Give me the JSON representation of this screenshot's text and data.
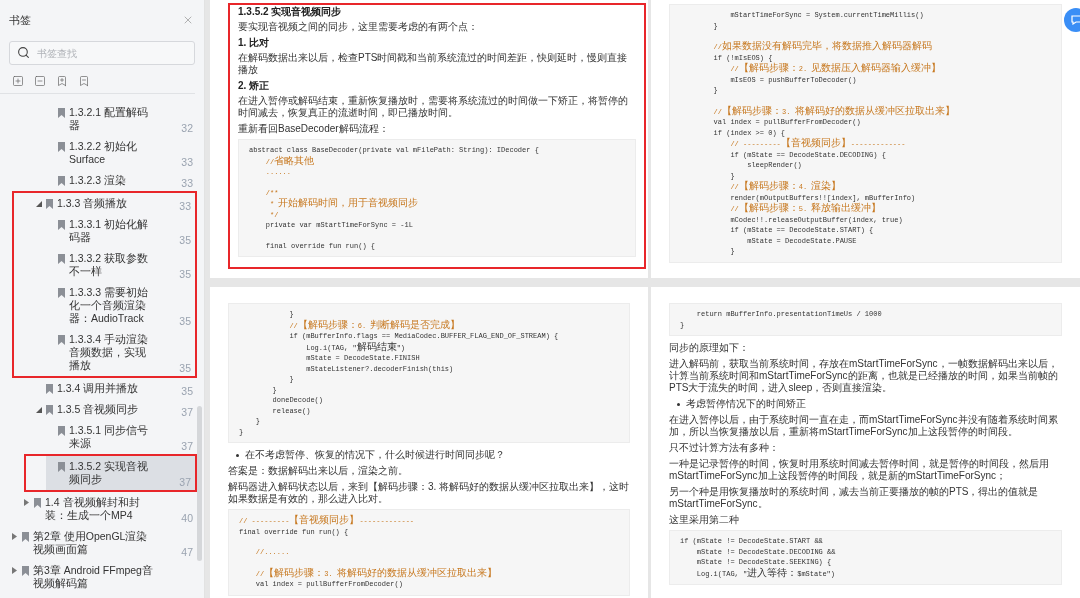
{
  "sidebar": {
    "title": "书签",
    "search": {
      "placeholder": "书签查找"
    },
    "tree": [
      {
        "children": [
          {
            "children": [
              {
                "children": [
                  {
                    "label": "1.3.2.1 配置解码器",
                    "page": "32",
                    "selected": false,
                    "annotated": false
                  },
                  {
                    "label": "1.3.2.2 初始化Surface",
                    "page": "33",
                    "selected": false,
                    "annotated": false
                  },
                  {
                    "label": "1.3.2.3 渲染",
                    "page": "33",
                    "selected": false,
                    "annotated": false
                  }
                ]
              },
              {
                "label": "1.3.3 音频播放",
                "page": "33",
                "expanded": true,
                "selected": false,
                "annotated": true,
                "children": [
                  {
                    "label": "1.3.3.1 初始化解码器",
                    "page": "35",
                    "selected": false,
                    "annotated": false
                  },
                  {
                    "label": "1.3.3.2 获取参数不一样",
                    "page": "35",
                    "selected": false,
                    "annotated": false
                  },
                  {
                    "label": "1.3.3.3 需要初始化一个音频渲染器：AudioTrack",
                    "page": "35",
                    "selected": false,
                    "annotated": false
                  },
                  {
                    "label": "1.3.3.4 手动渲染音频数据，实现播放",
                    "page": "35",
                    "selected": false,
                    "annotated": false
                  }
                ]
              },
              {
                "label": "1.3.4 调用并播放",
                "page": "35",
                "selected": false,
                "annotated": false
              },
              {
                "label": "1.3.5 音视频同步",
                "page": "37",
                "expanded": true,
                "selected": false,
                "annotated": false,
                "children": [
                  {
                    "label": "1.3.5.1 同步信号来源",
                    "page": "37",
                    "selected": false,
                    "annotated": false
                  },
                  {
                    "label": "1.3.5.2 实现音视频同步",
                    "page": "37",
                    "selected": true,
                    "annotated": true
                  }
                ]
              }
            ]
          },
          {
            "label": "1.4 音视频解封和封装：生成一个MP4",
            "page": "40",
            "expanded": false,
            "selected": false,
            "annotated": false
          }
        ]
      },
      {
        "label": "第2章 使用OpenGL渲染视频画面篇",
        "page": "47",
        "expanded": false,
        "selected": false,
        "annotated": false
      },
      {
        "label": "第3章 Android FFmpeg音视频解码篇",
        "expanded": false,
        "selected": false,
        "annotated": false
      }
    ]
  },
  "pages": [
    {
      "annotated": true,
      "blocks": [
        {
          "kind": "heading",
          "text": "1.3.5.2 实现音视频同步"
        },
        {
          "kind": "paragraph",
          "text": "要实现音视频之间的同步，这里需要考虑的有两个点："
        },
        {
          "kind": "heading",
          "text": "1. 比对"
        },
        {
          "kind": "paragraph",
          "text": "在解码数据出来以后，检查PTS时间戳和当前系统流过的时间差距，快则延时，慢则直接播放"
        },
        {
          "kind": "heading",
          "text": "2. 矫正"
        },
        {
          "kind": "paragraph",
          "text": "在进入暂停或解码结束，重新恢复播放时，需要将系统流过的时间做一下矫正，将暂停的时间减去，恢复真正的流逝时间，即已播放时间。"
        },
        {
          "kind": "paragraph",
          "text": "重新看回BaseDecoder解码流程："
        },
        {
          "kind": "code",
          "lines": [
            {
              "kind": "code",
              "text": "abstract class BaseDecoder(private val mFilePath: String): IDecoder {"
            },
            {
              "kind": "comment",
              "text": "    //省略其他"
            },
            {
              "kind": "comment",
              "text": "    ......"
            },
            {
              "kind": "blank"
            },
            {
              "kind": "comment",
              "text": "    /**"
            },
            {
              "kind": "comment",
              "text": "     * 开始解码时间，用于音视频同步"
            },
            {
              "kind": "comment",
              "text": "     */"
            },
            {
              "kind": "code",
              "text": "    private var mStartTimeForSync = -1L"
            },
            {
              "kind": "blank"
            },
            {
              "kind": "code",
              "text": "    final override fun run() {"
            }
          ]
        }
      ]
    },
    {
      "annotated": false,
      "blocks": [
        {
          "kind": "code",
          "lines": [
            {
              "kind": "code",
              "text": "            mStartTimeForSync = System.currentTimeMillis()"
            },
            {
              "kind": "code",
              "text": "        }"
            },
            {
              "kind": "blank"
            },
            {
              "kind": "comment",
              "text": "        //如果数据没有解码完毕，将数据推入解码器解码"
            },
            {
              "kind": "code",
              "text": "        if (!mIsEOS) {"
            },
            {
              "kind": "comment",
              "text": "            //【解码步骤：2. 见数据压入解码器输入缓冲】"
            },
            {
              "kind": "code",
              "text": "            mIsEOS = pushBufferToDecoder()"
            },
            {
              "kind": "code",
              "text": "        }"
            },
            {
              "kind": "blank"
            },
            {
              "kind": "comment",
              "text": "        //【解码步骤：3. 将解码好的数据从缓冲区拉取出来】"
            },
            {
              "kind": "code",
              "text": "        val index = pullBufferFromDecoder()"
            },
            {
              "kind": "code",
              "text": "        if (index >= 0) {"
            },
            {
              "kind": "comment",
              "text": "            // ---------【音视频同步】-------------"
            },
            {
              "kind": "code",
              "text": "            if (mState == DecodeState.DECODING) {"
            },
            {
              "kind": "code",
              "text": "                sleepRender()"
            },
            {
              "kind": "code",
              "text": "            }"
            },
            {
              "kind": "comment",
              "text": "            //【解码步骤：4. 渲染】"
            },
            {
              "kind": "code",
              "text": "            render(mOutputBuffers!![index], mBufferInfo)"
            },
            {
              "kind": "comment",
              "text": "            //【解码步骤：5. 释放输出缓冲】"
            },
            {
              "kind": "code",
              "text": "            mCodec!!.releaseOutputBuffer(index, true)"
            },
            {
              "kind": "code",
              "text": "            if (mState == DecodeState.START) {"
            },
            {
              "kind": "code",
              "text": "                mState = DecodeState.PAUSE"
            },
            {
              "kind": "code",
              "text": "            }"
            }
          ]
        }
      ]
    },
    {
      "annotated": false,
      "blocks": [
        {
          "kind": "code",
          "lines": [
            {
              "kind": "code",
              "text": "            }"
            },
            {
              "kind": "comment",
              "text": "            //【解码步骤：6. 判断解码是否完成】"
            },
            {
              "kind": "code",
              "text": "            if (mBufferInfo.flags == MediaCodec.BUFFER_FLAG_END_OF_STREAM) {"
            },
            {
              "kind": "code",
              "text": "                Log.i(TAG, \"解码结束\")"
            },
            {
              "kind": "code",
              "text": "                mState = DecodeState.FINISH"
            },
            {
              "kind": "code",
              "text": "                mStateListener?.decoderFinish(this)"
            },
            {
              "kind": "code",
              "text": "            }"
            },
            {
              "kind": "code",
              "text": "        }"
            },
            {
              "kind": "code",
              "text": "        doneDecode()"
            },
            {
              "kind": "code",
              "text": "        release()"
            },
            {
              "kind": "code",
              "text": "    }"
            },
            {
              "kind": "code",
              "text": "}"
            }
          ]
        },
        {
          "kind": "bullet",
          "text": "在不考虑暂停、恢复的情况下，什么时候进行时间同步呢？"
        },
        {
          "kind": "paragraph",
          "text": "答案是：数据解码出来以后，渲染之前。"
        },
        {
          "kind": "paragraph",
          "text": "解码器进入解码状态以后，来到【解码步骤：3. 将解码好的数据从缓冲区拉取出来】，这时如果数据是有效的，那么进入比对。"
        },
        {
          "kind": "code",
          "lines": [
            {
              "kind": "comment",
              "text": "// ---------【音视频同步】-------------"
            },
            {
              "kind": "code",
              "text": "final override fun run() {"
            },
            {
              "kind": "blank"
            },
            {
              "kind": "comment",
              "text": "    //......"
            },
            {
              "kind": "blank"
            },
            {
              "kind": "comment",
              "text": "    //【解码步骤：3. 将解码好的数据从缓冲区拉取出来】"
            },
            {
              "kind": "code",
              "text": "    val index = pullBufferFromDecoder()"
            }
          ]
        }
      ]
    },
    {
      "annotated": false,
      "blocks": [
        {
          "kind": "code",
          "lines": [
            {
              "kind": "code",
              "text": "    return mBufferInfo.presentationTimeUs / 1000"
            },
            {
              "kind": "code",
              "text": "}"
            }
          ]
        },
        {
          "kind": "paragraph",
          "text": "同步的原理如下："
        },
        {
          "kind": "paragraph",
          "text": "进入解码前，获取当前系统时间，存放在mStartTimeForSync，一帧数据解码出来以后，计算当前系统时间和mStartTimeForSync的距离，也就是已经播放的时间，如果当前帧的PTS大于流失的时间，进入sleep，否则直接渲染。"
        },
        {
          "kind": "bullet",
          "text": "考虑暂停情况下的时间矫正"
        },
        {
          "kind": "paragraph",
          "text": "在进入暂停以后，由于系统时间一直在走，而mStartTimeForSync并没有随着系统时间累加，所以当恢复播放以后，重新将mStartTimeForSync加上这段暂停的时间段。"
        },
        {
          "kind": "paragraph",
          "text": "只不过计算方法有多种："
        },
        {
          "kind": "paragraph",
          "text": "一种是记录暂停的时间，恢复时用系统时间减去暂停时间，就是暂停的时间段，然后用mStartTimeForSync加上这段暂停的时间段，就是新的mStartTimeForSync；"
        },
        {
          "kind": "paragraph",
          "text": "另一个种是用恢复播放时的系统时间，减去当前正要播放的帧的PTS，得出的值就是mStartTimeForSync。"
        },
        {
          "kind": "paragraph",
          "text": "这里采用第二种"
        },
        {
          "kind": "code",
          "lines": [
            {
              "kind": "code",
              "text": "if (mState != DecodeState.START &&"
            },
            {
              "kind": "code",
              "text": "    mState != DecodeState.DECODING &&"
            },
            {
              "kind": "code",
              "text": "    mState != DecodeState.SEEKING) {"
            },
            {
              "kind": "code",
              "text": "    Log.i(TAG, \"进入等待：$mState\")"
            }
          ]
        }
      ]
    }
  ]
}
